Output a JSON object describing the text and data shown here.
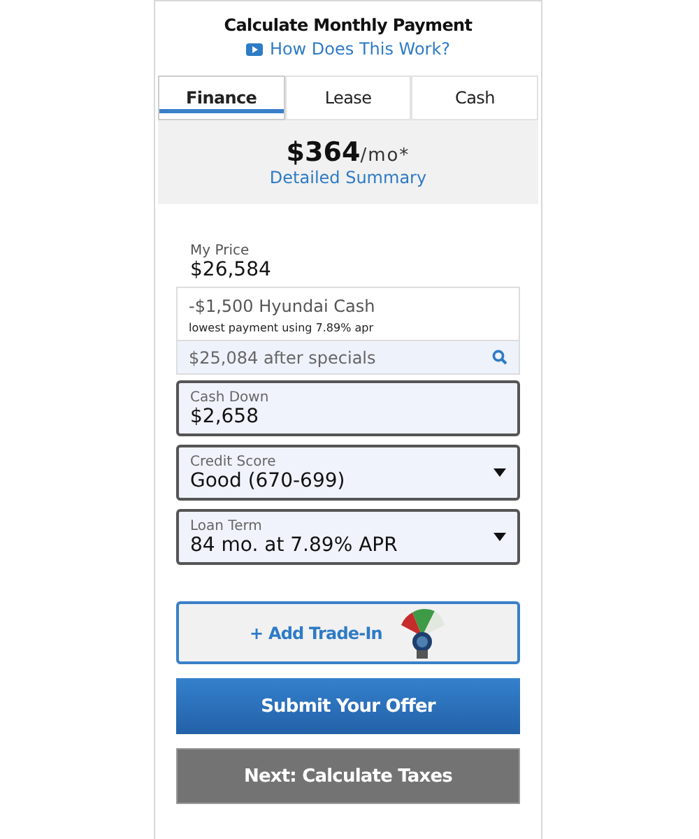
{
  "header": {
    "title": "Calculate Monthly Payment",
    "help_link": "How Does This Work?"
  },
  "tabs": [
    {
      "label": "Finance",
      "selected": true
    },
    {
      "label": "Lease",
      "selected": false
    },
    {
      "label": "Cash",
      "selected": false
    }
  ],
  "summary": {
    "amount": "$364",
    "unit": "/mo*",
    "link": "Detailed Summary"
  },
  "price": {
    "label": "My Price",
    "value": "$26,584"
  },
  "specials": {
    "rebate": "-$1,500 Hyundai Cash",
    "note": "lowest payment using 7.89% apr",
    "after": "$25,084 after specials"
  },
  "fields": [
    {
      "kind": "input",
      "label": "Cash Down",
      "value": "$2,658"
    },
    {
      "kind": "select",
      "label": "Credit Score",
      "value": "Good (670-699)"
    },
    {
      "kind": "select",
      "label": "Loan Term",
      "value": "84 mo. at 7.89% APR"
    }
  ],
  "buttons": [
    {
      "kind": "trade",
      "label": "+ Add Trade-In"
    },
    {
      "kind": "primary",
      "label": "Submit Your Offer"
    },
    {
      "kind": "secondary",
      "label": "Next: Calculate Taxes"
    }
  ]
}
